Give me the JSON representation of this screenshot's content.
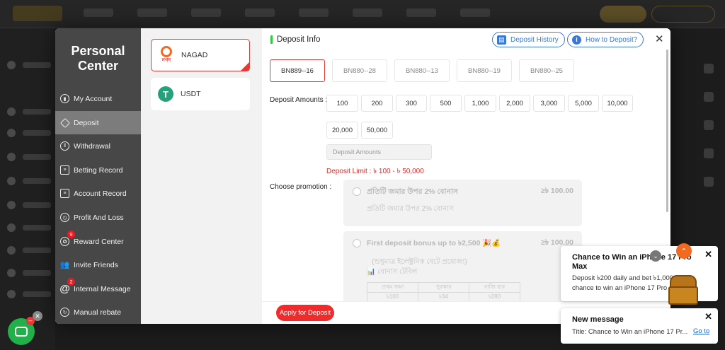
{
  "sidebar": {
    "title": "Personal Center",
    "items": [
      {
        "label": "My Account"
      },
      {
        "label": "Deposit"
      },
      {
        "label": "Withdrawal"
      },
      {
        "label": "Betting Record"
      },
      {
        "label": "Account Record"
      },
      {
        "label": "Profit And Loss"
      },
      {
        "label": "Reward Center",
        "badge": "9"
      },
      {
        "label": "Invite Friends"
      },
      {
        "label": "Internal Message",
        "badge": "2"
      },
      {
        "label": "Manual rebate"
      }
    ]
  },
  "payment_methods": [
    {
      "label": "NAGAD",
      "logo_text": "নগদ"
    },
    {
      "label": "USDT",
      "logo_text": "T"
    }
  ],
  "deposit": {
    "title": "Deposit Info",
    "history_label": "Deposit History",
    "how_to_label": "How to Deposit?",
    "channels": [
      "BN889--16",
      "BN880--28",
      "BN880--13",
      "BN880--19",
      "BN880--25"
    ],
    "amounts_label": "Deposit Amounts :",
    "amounts": [
      "100",
      "200",
      "300",
      "500",
      "1,000",
      "2,000",
      "3,000",
      "5,000",
      "10,000",
      "20,000",
      "50,000"
    ],
    "amount_placeholder": "Deposit Amounts",
    "limit_text": "Deposit Limit : ৳ 100 - ৳ 50,000",
    "promotion_label": "Choose promotion :",
    "promotions": [
      {
        "title": "প্রতিটি জমার উপর 2% বোনাস",
        "amount": "≥৳ 100.00",
        "desc": "প্রতিটি জমার উপর 2% বোনাস"
      },
      {
        "title": "First deposit bonus up to ৳2,500 🎉💰",
        "amount": "≥৳ 100.00",
        "desc1": "(শুধুমাত্র ইলেক্ট্রনিক বেটে প্রযোজ্য)",
        "desc2": "📊 বোনাস টেবিল",
        "table": [
          [
            "প্রথম জমা",
            "পুরস্কার",
            "বাজি হার"
          ],
          [
            "৳100",
            "৳34",
            "৳280"
          ]
        ]
      }
    ],
    "apply_label": "Apply for Deposit"
  },
  "notifications": {
    "promo_title": "Chance to Win an iPhone 17 Pro Max",
    "promo_body_1": "Deposit ৳200 daily and bet ৳1,000",
    "promo_body_2": "chance to win an iPhone 17 Pro",
    "message_title": "New message",
    "message_body": "Title: Chance to Win an iPhone 17 Pr...",
    "goto_label": "Go to"
  },
  "colors": {
    "accent_red": "#e53935",
    "link_blue": "#3a78d8",
    "sidebar_bg": "#474747",
    "green": "#22b04a"
  },
  "icons": [
    "account-icon",
    "deposit-icon",
    "withdrawal-icon",
    "betting-record-icon",
    "account-record-icon",
    "profit-loss-icon",
    "reward-icon",
    "invite-icon",
    "message-icon",
    "rebate-icon",
    "chat-icon",
    "close-icon",
    "arrow-up-icon"
  ]
}
